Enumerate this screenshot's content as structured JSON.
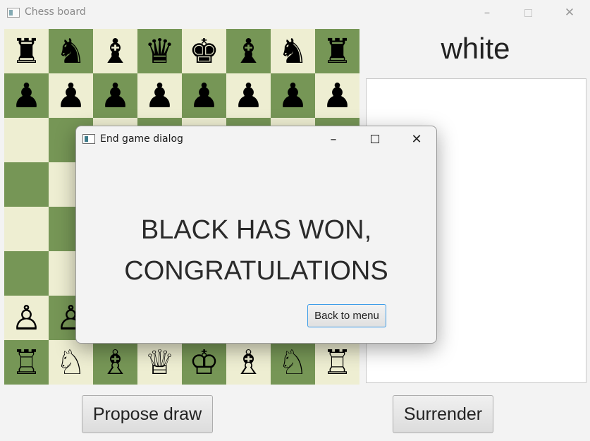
{
  "window": {
    "title": "Chess board",
    "minimize_icon": "–",
    "close_icon": "✕"
  },
  "turn_label": "white",
  "board": {
    "rows": [
      [
        "♜",
        "♞",
        "♝",
        "♛",
        "♚",
        "♝",
        "♞",
        "♜"
      ],
      [
        "♟",
        "♟",
        "♟",
        "♟",
        "♟",
        "♟",
        "♟",
        "♟"
      ],
      [
        "",
        "",
        "",
        "",
        "",
        "",
        "",
        ""
      ],
      [
        "",
        "",
        "",
        "",
        "",
        "",
        "",
        ""
      ],
      [
        "",
        "",
        "",
        "",
        "",
        "",
        "",
        ""
      ],
      [
        "",
        "",
        "",
        "",
        "",
        "",
        "",
        ""
      ],
      [
        "♙",
        "♙",
        "♙",
        "♙",
        "♙",
        "♙",
        "♙",
        "♙"
      ],
      [
        "♖",
        "♘",
        "♗",
        "♕",
        "♔",
        "♗",
        "♘",
        "♖"
      ]
    ],
    "light_color": "#eeeed2",
    "dark_color": "#769656"
  },
  "buttons": {
    "propose_draw": "Propose draw",
    "surrender": "Surrender"
  },
  "dialog": {
    "title": "End game dialog",
    "message_line1": "BLACK HAS WON,",
    "message_line2": "CONGRATULATIONS",
    "back_button": "Back to menu",
    "minimize_icon": "–",
    "close_icon": "✕"
  }
}
